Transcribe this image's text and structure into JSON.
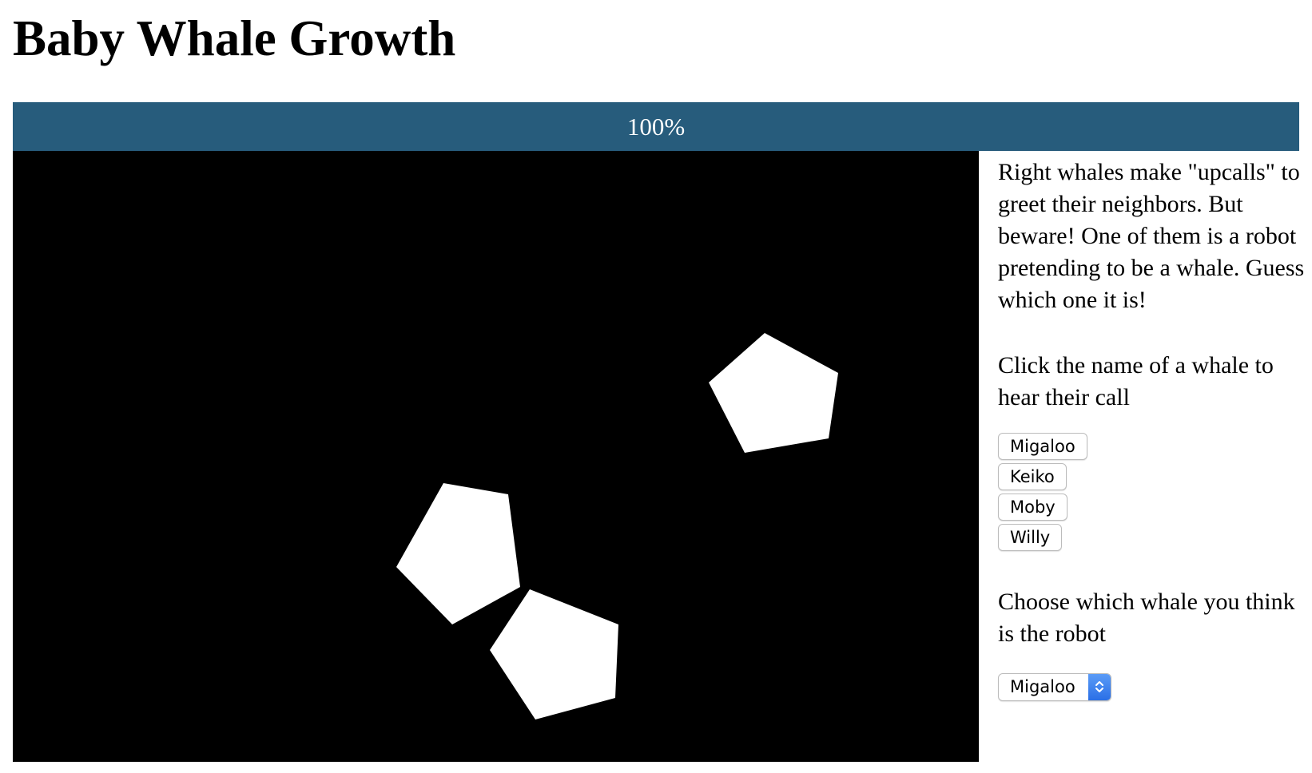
{
  "page": {
    "title": "Baby Whale Growth"
  },
  "progress": {
    "label": "100%",
    "value": 1.0,
    "color": "#275c7c"
  },
  "scene": {
    "background": "#000000",
    "shape_color": "#ffffff",
    "shapes": [
      "pentagon",
      "pentagon",
      "pentagon"
    ]
  },
  "sidebar": {
    "intro": "Right whales make \"upcalls\" to greet their neighbors. But beware! One of them is a robot pretending to be a whale. Guess which one it is!",
    "instruction": "Click the name of a whale to hear their call",
    "whales": [
      "Migaloo",
      "Keiko",
      "Moby",
      "Willy"
    ],
    "choose_prompt": "Choose which whale you think is the robot",
    "robot_select": {
      "selected": "Migaloo",
      "arrow_icon": "chevron-up-down-icon",
      "arrow_color": "#3b82f0"
    }
  }
}
